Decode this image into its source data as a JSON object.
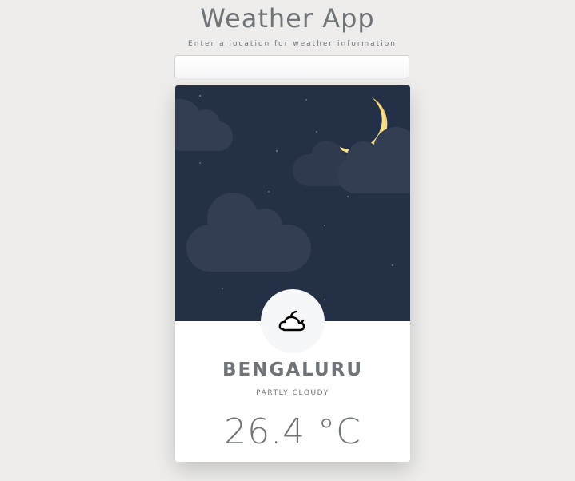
{
  "app": {
    "title": "Weather App",
    "subtitle": "Enter a location for weather information"
  },
  "search": {
    "value": "",
    "placeholder": ""
  },
  "weather": {
    "city": "BENGALURU",
    "condition": "PARTLY CLOUDY",
    "temperature": "26.4 °C",
    "icon": "partly-cloudy-night-icon"
  },
  "colors": {
    "sky": "#233046",
    "cloud": "#333e52",
    "moon": "#fbe08a",
    "text": "#6e7478",
    "background": "#eeedeb"
  }
}
